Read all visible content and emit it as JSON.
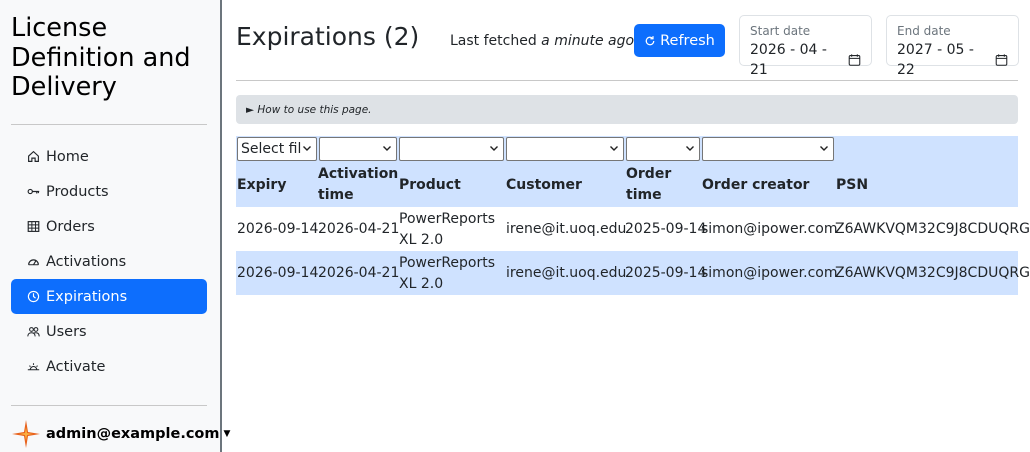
{
  "app": {
    "title": "License Definition and Delivery"
  },
  "sidebar": {
    "items": [
      {
        "label": "Home",
        "icon": "house-icon",
        "active": false
      },
      {
        "label": "Products",
        "icon": "key-icon",
        "active": false
      },
      {
        "label": "Orders",
        "icon": "table-icon",
        "active": false
      },
      {
        "label": "Activations",
        "icon": "speedometer-icon",
        "active": false
      },
      {
        "label": "Expirations",
        "icon": "clock-icon",
        "active": true
      },
      {
        "label": "Users",
        "icon": "people-icon",
        "active": false
      },
      {
        "label": "Activate",
        "icon": "sunrise-icon",
        "active": false
      }
    ],
    "user": "admin@example.com"
  },
  "header": {
    "title": "Expirations (2)",
    "last_fetched_prefix": "Last fetched",
    "last_fetched_value": "a minute ago.",
    "refresh_label": "Refresh",
    "start_date": {
      "label": "Start date",
      "value": "2026 - 04 - 21"
    },
    "end_date": {
      "label": "End date",
      "value": "2027 - 05 - 22"
    }
  },
  "help": {
    "label": "► How to use this page."
  },
  "table": {
    "filters": [
      "Select fil",
      "",
      "",
      "",
      "",
      ""
    ],
    "columns": [
      {
        "line1": "Expiry",
        "line2": ""
      },
      {
        "line1": "Activation",
        "line2": "time"
      },
      {
        "line1": "Product",
        "line2": ""
      },
      {
        "line1": "Customer",
        "line2": ""
      },
      {
        "line1": "Order",
        "line2": "time"
      },
      {
        "line1": "Order creator",
        "line2": ""
      },
      {
        "line1": "PSN",
        "line2": ""
      }
    ],
    "rows": [
      {
        "expiry": "2026-09-14",
        "activation": "2026-04-21",
        "product1": "PowerReports",
        "product2": "XL 2.0",
        "customer": "irene@it.uoq.edu",
        "order_time": "2025-09-14",
        "creator": "simon@ipower.com",
        "psn": "Z6AWKVQM32C9J8CDUQRG"
      },
      {
        "expiry": "2026-09-14",
        "activation": "2026-04-21",
        "product1": "PowerReports",
        "product2": "XL 2.0",
        "customer": "irene@it.uoq.edu",
        "order_time": "2025-09-14",
        "creator": "simon@ipower.com",
        "psn": "Z6AWKVQM32C9J8CDUQRG"
      }
    ]
  },
  "colors": {
    "accent": "#0d6efd",
    "row_highlight": "#cfe2ff",
    "sidebar_bg": "#f8f9fa"
  }
}
